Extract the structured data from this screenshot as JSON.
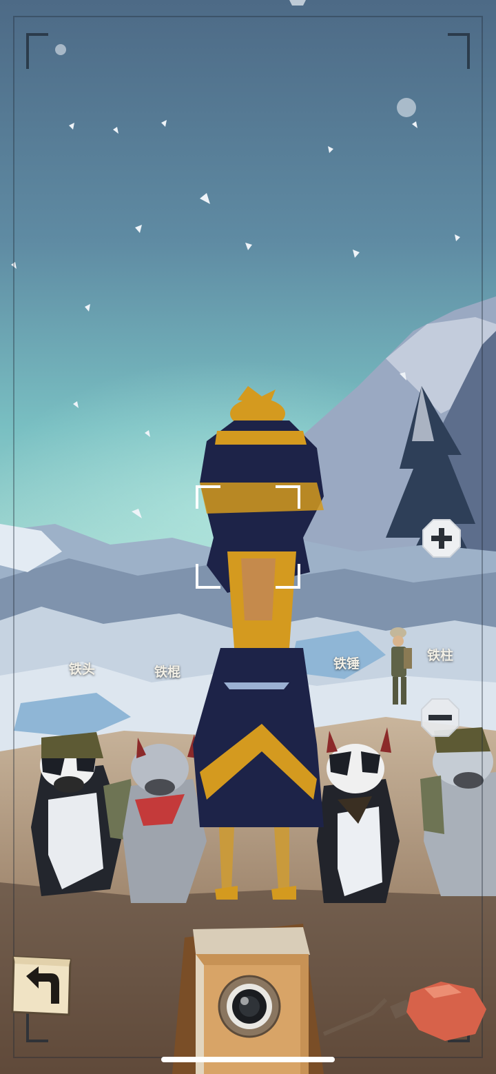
{
  "labels": {
    "dog1": "铁头",
    "dog2": "铁棍",
    "dog3": "铁锤",
    "dog4": "铁柱"
  },
  "controls": {
    "zoom_in": "plus-icon",
    "zoom_out": "minus-icon",
    "back": "back-arrow-icon",
    "shutter": "camera-lens-icon",
    "trigger": "shutter-bulb-icon"
  },
  "colors": {
    "sky_top": "#4f6d8a",
    "sky_glow": "#7fc6c6",
    "snow": "#dde6ee",
    "ground": "#a8896c",
    "cloak": "#1d2348",
    "gold": "#d49a1f",
    "camera_wood": "#b07e43"
  }
}
